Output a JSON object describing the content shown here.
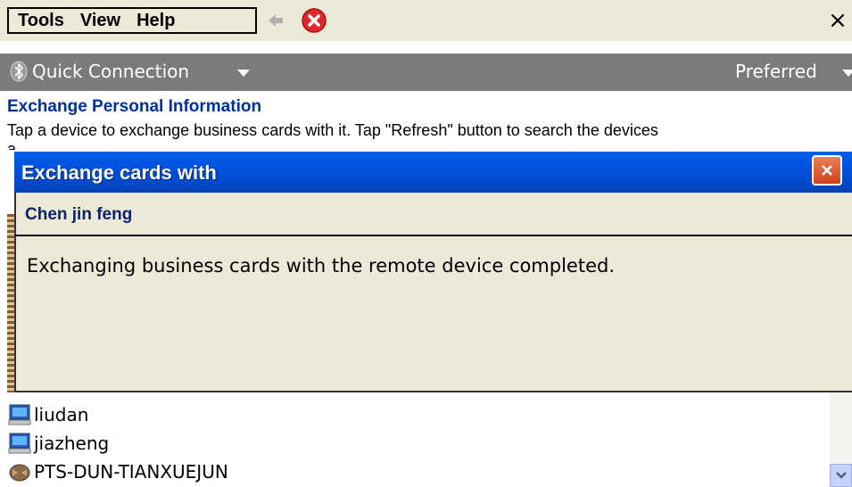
{
  "menubar": {
    "items": [
      {
        "label": "Tools"
      },
      {
        "label": "View"
      },
      {
        "label": "Help"
      }
    ],
    "close_label": "×"
  },
  "commandbar": {
    "quick_connection_label": "Quick Connection",
    "preferred_label": "Preferred"
  },
  "page": {
    "title": "Exchange Personal Information",
    "description": "Tap a device to exchange business cards with it. Tap \"Refresh\" button to search the devices",
    "description_overflow": "a"
  },
  "dialog": {
    "title": "Exchange cards with",
    "subject": "Chen jin feng",
    "message": "Exchanging business cards with the remote device completed."
  },
  "devices": [
    {
      "name": "liudan",
      "icon": "computer-icon"
    },
    {
      "name": "jiazheng",
      "icon": "computer-icon"
    },
    {
      "name": "PTS-DUN-TIANXUEJUN",
      "icon": "phone-icon"
    }
  ],
  "colors": {
    "accent": "#0054e3",
    "title_text": "#003399",
    "close_red": "#d0421c",
    "command_bar": "#7b7b7b"
  }
}
